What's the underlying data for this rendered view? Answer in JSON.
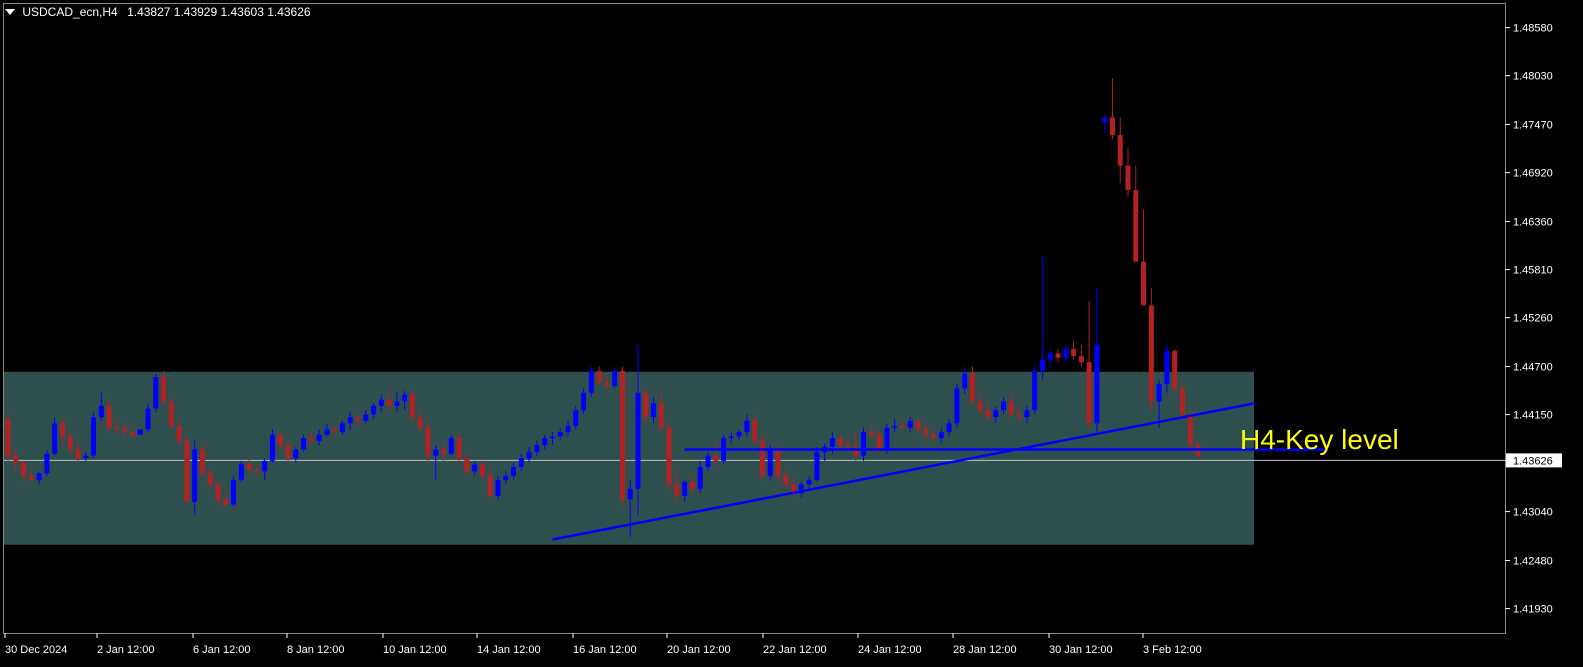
{
  "header": {
    "symbol": "USDCAD_ecn,H4",
    "ohlc": "1.43827 1.43929 1.43603 1.43626"
  },
  "annotation": {
    "text": "H4-Key level"
  },
  "current_price_label": "1.43626",
  "colors": {
    "background": "#000000",
    "bull": "#0000ff",
    "bear": "#b22222",
    "zone": "#2f4f4f",
    "trendline": "#0000ff",
    "annotation": "#ffff00",
    "axis": "#ffffff"
  },
  "chart_data": {
    "type": "candlestick",
    "ylim": [
      1.4165,
      1.4885
    ],
    "y_ticks": [
      "1.48580",
      "1.48030",
      "1.47470",
      "1.46920",
      "1.46360",
      "1.45810",
      "1.45260",
      "1.44700",
      "1.44150",
      "1.43626",
      "1.43040",
      "1.42480",
      "1.41930"
    ],
    "x_ticks": [
      "30 Dec 2024",
      "2 Jan 12:00",
      "6 Jan 12:00",
      "8 Jan 12:00",
      "10 Jan 12:00",
      "14 Jan 12:00",
      "16 Jan 12:00",
      "20 Jan 12:00",
      "22 Jan 12:00",
      "24 Jan 12:00",
      "28 Jan 12:00",
      "30 Jan 12:00",
      "3 Feb 12:00"
    ],
    "current_price": 1.43626,
    "zone": {
      "top": 1.4464,
      "bottom": 1.4266
    },
    "horizontal_level": 1.4375,
    "trendline": {
      "from": 1.4272,
      "to": 1.4428
    },
    "candles": [
      [
        1.441,
        1.4415,
        1.436,
        1.4368
      ],
      [
        1.4368,
        1.4375,
        1.435,
        1.436
      ],
      [
        1.436,
        1.4362,
        1.434,
        1.4345
      ],
      [
        1.4345,
        1.4352,
        1.4338,
        1.434
      ],
      [
        1.434,
        1.435,
        1.4335,
        1.4348
      ],
      [
        1.4348,
        1.4375,
        1.4345,
        1.437
      ],
      [
        1.437,
        1.4412,
        1.4368,
        1.4405
      ],
      [
        1.4405,
        1.441,
        1.438,
        1.439
      ],
      [
        1.439,
        1.4395,
        1.4368,
        1.4375
      ],
      [
        1.4375,
        1.4382,
        1.436,
        1.4365
      ],
      [
        1.4365,
        1.4372,
        1.4362,
        1.4368
      ],
      [
        1.4368,
        1.4418,
        1.4365,
        1.4412
      ],
      [
        1.4412,
        1.444,
        1.4408,
        1.4425
      ],
      [
        1.4425,
        1.4432,
        1.4395,
        1.44
      ],
      [
        1.44,
        1.441,
        1.4392,
        1.4398
      ],
      [
        1.4398,
        1.4405,
        1.439,
        1.4395
      ],
      [
        1.4395,
        1.44,
        1.4388,
        1.4392
      ],
      [
        1.4392,
        1.4398,
        1.4392,
        1.4398
      ],
      [
        1.4398,
        1.4428,
        1.4395,
        1.4422
      ],
      [
        1.4422,
        1.4462,
        1.4418,
        1.4458
      ],
      [
        1.4458,
        1.4465,
        1.4425,
        1.443
      ],
      [
        1.443,
        1.4435,
        1.4398,
        1.4402
      ],
      [
        1.4402,
        1.441,
        1.438,
        1.4385
      ],
      [
        1.4385,
        1.4392,
        1.432,
        1.4315
      ],
      [
        1.4315,
        1.4385,
        1.43,
        1.4375
      ],
      [
        1.4375,
        1.4382,
        1.4345,
        1.4348
      ],
      [
        1.4348,
        1.4352,
        1.433,
        1.4335
      ],
      [
        1.4335,
        1.434,
        1.4312,
        1.4318
      ],
      [
        1.4318,
        1.4325,
        1.431,
        1.4312
      ],
      [
        1.4312,
        1.4345,
        1.431,
        1.434
      ],
      [
        1.434,
        1.4362,
        1.4338,
        1.4358
      ],
      [
        1.4358,
        1.4365,
        1.4348,
        1.4352
      ],
      [
        1.4352,
        1.4358,
        1.4345,
        1.435
      ],
      [
        1.435,
        1.4365,
        1.434,
        1.4362
      ],
      [
        1.4362,
        1.4398,
        1.436,
        1.4392
      ],
      [
        1.4392,
        1.4395,
        1.4375,
        1.438
      ],
      [
        1.438,
        1.4385,
        1.436,
        1.4365
      ],
      [
        1.4365,
        1.4378,
        1.436,
        1.4375
      ],
      [
        1.4375,
        1.4392,
        1.4372,
        1.4388
      ],
      [
        1.4388,
        1.4395,
        1.438,
        1.4385
      ],
      [
        1.4385,
        1.4398,
        1.438,
        1.4392
      ],
      [
        1.4392,
        1.4405,
        1.439,
        1.4398
      ],
      [
        1.4398,
        1.4402,
        1.4392,
        1.4395
      ],
      [
        1.4395,
        1.4408,
        1.4392,
        1.4405
      ],
      [
        1.4405,
        1.4418,
        1.4398,
        1.4412
      ],
      [
        1.4412,
        1.4415,
        1.4402,
        1.4408
      ],
      [
        1.4408,
        1.442,
        1.4405,
        1.4415
      ],
      [
        1.4415,
        1.4428,
        1.441,
        1.4425
      ],
      [
        1.4425,
        1.4438,
        1.4418,
        1.4432
      ],
      [
        1.4432,
        1.444,
        1.442,
        1.4425
      ],
      [
        1.4425,
        1.444,
        1.4418,
        1.443
      ],
      [
        1.443,
        1.4442,
        1.442,
        1.4438
      ],
      [
        1.4438,
        1.4442,
        1.4405,
        1.4412
      ],
      [
        1.4412,
        1.442,
        1.4395,
        1.44
      ],
      [
        1.44,
        1.4408,
        1.436,
        1.4368
      ],
      [
        1.4368,
        1.438,
        1.434,
        1.4375
      ],
      [
        1.4375,
        1.4382,
        1.4362,
        1.437
      ],
      [
        1.437,
        1.4392,
        1.4368,
        1.4388
      ],
      [
        1.4388,
        1.4395,
        1.436,
        1.4365
      ],
      [
        1.4365,
        1.4372,
        1.4345,
        1.435
      ],
      [
        1.435,
        1.4362,
        1.4345,
        1.4358
      ],
      [
        1.4358,
        1.4362,
        1.434,
        1.4345
      ],
      [
        1.4345,
        1.4352,
        1.4318,
        1.4322
      ],
      [
        1.4322,
        1.4345,
        1.4318,
        1.434
      ],
      [
        1.434,
        1.435,
        1.4335,
        1.4345
      ],
      [
        1.4345,
        1.436,
        1.434,
        1.4355
      ],
      [
        1.4355,
        1.437,
        1.435,
        1.4365
      ],
      [
        1.4365,
        1.4378,
        1.436,
        1.4372
      ],
      [
        1.4372,
        1.4385,
        1.4368,
        1.438
      ],
      [
        1.438,
        1.4392,
        1.4375,
        1.4388
      ],
      [
        1.4388,
        1.4395,
        1.438,
        1.439
      ],
      [
        1.439,
        1.44,
        1.4385,
        1.4395
      ],
      [
        1.4395,
        1.4408,
        1.439,
        1.4402
      ],
      [
        1.4402,
        1.4425,
        1.4398,
        1.442
      ],
      [
        1.442,
        1.4445,
        1.4415,
        1.444
      ],
      [
        1.444,
        1.447,
        1.4435,
        1.4465
      ],
      [
        1.4465,
        1.447,
        1.4448,
        1.4452
      ],
      [
        1.4452,
        1.4462,
        1.4445,
        1.4448
      ],
      [
        1.4448,
        1.447,
        1.4445,
        1.4465
      ],
      [
        1.4465,
        1.447,
        1.431,
        1.4318
      ],
      [
        1.4318,
        1.434,
        1.4275,
        1.433
      ],
      [
        1.433,
        1.4495,
        1.43,
        1.444
      ],
      [
        1.444,
        1.4445,
        1.4405,
        1.4412
      ],
      [
        1.4412,
        1.4435,
        1.4405,
        1.4428
      ],
      [
        1.4428,
        1.444,
        1.4395,
        1.44
      ],
      [
        1.44,
        1.4408,
        1.433,
        1.4335
      ],
      [
        1.4335,
        1.4352,
        1.4315,
        1.4322
      ],
      [
        1.4322,
        1.434,
        1.4315,
        1.4338
      ],
      [
        1.4338,
        1.4345,
        1.4325,
        1.433
      ],
      [
        1.433,
        1.4362,
        1.4325,
        1.4355
      ],
      [
        1.4355,
        1.4372,
        1.435,
        1.4368
      ],
      [
        1.4368,
        1.4382,
        1.4355,
        1.4362
      ],
      [
        1.4362,
        1.4392,
        1.4358,
        1.4388
      ],
      [
        1.4388,
        1.4395,
        1.4382,
        1.439
      ],
      [
        1.439,
        1.4398,
        1.4385,
        1.4395
      ],
      [
        1.4395,
        1.4415,
        1.439,
        1.4408
      ],
      [
        1.4408,
        1.4415,
        1.438,
        1.4385
      ],
      [
        1.4385,
        1.4392,
        1.434,
        1.4345
      ],
      [
        1.4345,
        1.438,
        1.434,
        1.4375
      ],
      [
        1.4375,
        1.438,
        1.434,
        1.4345
      ],
      [
        1.4345,
        1.4352,
        1.433,
        1.4335
      ],
      [
        1.4335,
        1.4345,
        1.432,
        1.4325
      ],
      [
        1.4325,
        1.4338,
        1.432,
        1.4335
      ],
      [
        1.4335,
        1.4345,
        1.433,
        1.434
      ],
      [
        1.434,
        1.4378,
        1.4338,
        1.4372
      ],
      [
        1.4372,
        1.4382,
        1.4362,
        1.4378
      ],
      [
        1.4378,
        1.4395,
        1.437,
        1.4388
      ],
      [
        1.4388,
        1.4392,
        1.4375,
        1.438
      ],
      [
        1.438,
        1.4388,
        1.4372,
        1.4378
      ],
      [
        1.4378,
        1.4395,
        1.4362,
        1.4368
      ],
      [
        1.4368,
        1.44,
        1.4362,
        1.4395
      ],
      [
        1.4395,
        1.4402,
        1.4388,
        1.4392
      ],
      [
        1.4392,
        1.4398,
        1.437,
        1.4375
      ],
      [
        1.4375,
        1.4405,
        1.437,
        1.44
      ],
      [
        1.44,
        1.441,
        1.4395,
        1.4402
      ],
      [
        1.4402,
        1.4408,
        1.4398,
        1.44
      ],
      [
        1.44,
        1.4412,
        1.4395,
        1.4408
      ],
      [
        1.4408,
        1.441,
        1.4395,
        1.4398
      ],
      [
        1.4398,
        1.4405,
        1.4385,
        1.4392
      ],
      [
        1.4392,
        1.44,
        1.4385,
        1.4388
      ],
      [
        1.4388,
        1.44,
        1.4382,
        1.4395
      ],
      [
        1.4395,
        1.441,
        1.439,
        1.4405
      ],
      [
        1.4405,
        1.445,
        1.44,
        1.4445
      ],
      [
        1.4445,
        1.447,
        1.4438,
        1.4462
      ],
      [
        1.4462,
        1.447,
        1.4425,
        1.443
      ],
      [
        1.443,
        1.444,
        1.4415,
        1.442
      ],
      [
        1.442,
        1.4428,
        1.4408,
        1.4412
      ],
      [
        1.4412,
        1.4425,
        1.4405,
        1.442
      ],
      [
        1.442,
        1.4435,
        1.4415,
        1.443
      ],
      [
        1.443,
        1.444,
        1.4412,
        1.4415
      ],
      [
        1.4415,
        1.4422,
        1.4408,
        1.4412
      ],
      [
        1.4412,
        1.4425,
        1.4405,
        1.442
      ],
      [
        1.442,
        1.4472,
        1.4415,
        1.4465
      ],
      [
        1.4465,
        1.4598,
        1.4455,
        1.4478
      ],
      [
        1.4478,
        1.449,
        1.447,
        1.4485
      ],
      [
        1.4485,
        1.449,
        1.4475,
        1.448
      ],
      [
        1.448,
        1.4495,
        1.4475,
        1.449
      ],
      [
        1.449,
        1.45,
        1.4478,
        1.4482
      ],
      [
        1.4482,
        1.4495,
        1.447,
        1.4475
      ],
      [
        1.4475,
        1.4545,
        1.44,
        1.4405
      ],
      [
        1.4405,
        1.456,
        1.4395,
        1.4495
      ],
      [
        1.475,
        1.4758,
        1.4738,
        1.4755
      ],
      [
        1.4755,
        1.48,
        1.473,
        1.4735
      ],
      [
        1.4735,
        1.4755,
        1.468,
        1.47
      ],
      [
        1.47,
        1.472,
        1.4665,
        1.4672
      ],
      [
        1.4672,
        1.47,
        1.46,
        1.459
      ],
      [
        1.459,
        1.465,
        1.4565,
        1.454
      ],
      [
        1.454,
        1.456,
        1.442,
        1.443
      ],
      [
        1.443,
        1.4455,
        1.44,
        1.445
      ],
      [
        1.445,
        1.4495,
        1.444,
        1.4488
      ],
      [
        1.4488,
        1.449,
        1.444,
        1.4445
      ],
      [
        1.4445,
        1.4448,
        1.441,
        1.4415
      ],
      [
        1.4415,
        1.442,
        1.437,
        1.438
      ],
      [
        1.438,
        1.4385,
        1.4365,
        1.4368
      ]
    ]
  }
}
